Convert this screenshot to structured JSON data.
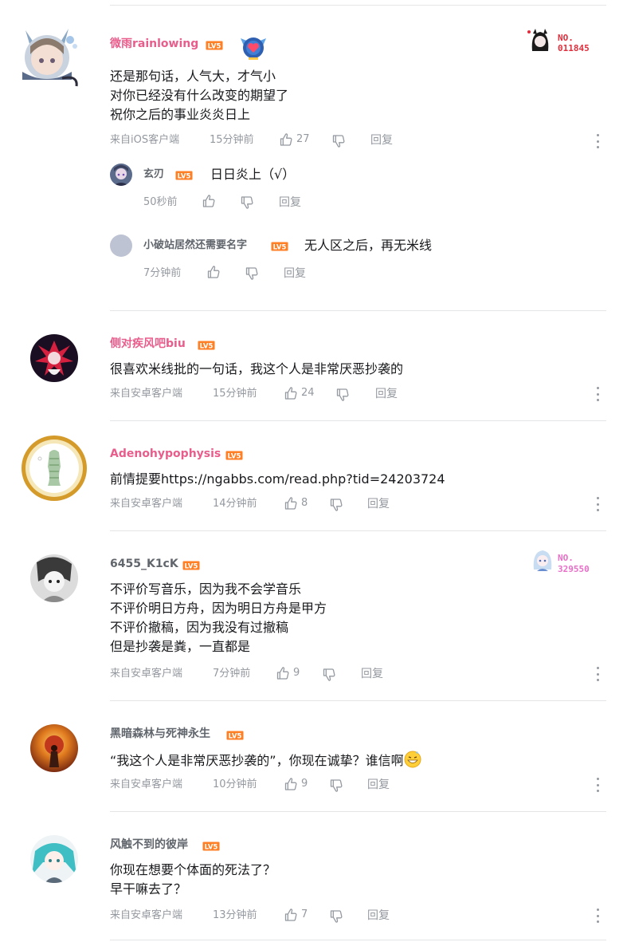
{
  "level_badge": "LV5",
  "colors": {
    "pink_name": "#e85d8c",
    "gray_name": "#61666d",
    "meta": "#9499a0",
    "badge_orange": "#ff7f24",
    "fan_red": "#e02e3c",
    "fan_pink": "#e86ec8"
  },
  "comments": [
    {
      "user": "微雨rainlowing",
      "lines": [
        "还是那句话，人气大，才气小",
        "对你已经没有什么改变的期望了",
        "祝你之后的事业炎炎日上"
      ],
      "source": "来自iOS客户端",
      "time": "15分钟前",
      "likes": "27",
      "reply": "回复",
      "fan_badge": {
        "label": "NO.",
        "number": "011845"
      },
      "replies": [
        {
          "user": "玄刃",
          "text": "日日炎上（√）",
          "time": "50秒前",
          "reply": "回复"
        },
        {
          "user": "小破站居然还需要名字",
          "text": "无人区之后，再无米线",
          "time": "7分钟前",
          "reply": "回复"
        }
      ]
    },
    {
      "user": "侧对疾风吧biu",
      "lines": [
        "很喜欢米线批的一句话，我这个人是非常厌恶抄袭的"
      ],
      "source": "来自安卓客户端",
      "time": "15分钟前",
      "likes": "24",
      "reply": "回复"
    },
    {
      "user": "Adenohypophysis",
      "lines": [
        "前情提要https://ngabbs.com/read.php?tid=24203724"
      ],
      "source": "来自安卓客户端",
      "time": "14分钟前",
      "likes": "8",
      "reply": "回复"
    },
    {
      "user": "6455_K1cK",
      "lines": [
        "不评价写音乐，因为我不会学音乐",
        "不评价明日方舟，因为明日方舟是甲方",
        "不评价撤稿，因为我没有过撤稿",
        "但是抄袭是粪，一直都是"
      ],
      "source": "来自安卓客户端",
      "time": "7分钟前",
      "likes": "9",
      "reply": "回复",
      "fan_badge": {
        "label": "NO.",
        "number": "329550"
      }
    },
    {
      "user": "黑暗森林与死神永生",
      "lines": [
        "“我这个人是非常厌恶抄袭的”，你现在诚挚？谁信啊"
      ],
      "source": "来自安卓客户端",
      "time": "10分钟前",
      "likes": "9",
      "reply": "回复"
    },
    {
      "user": "风触不到的彼岸",
      "lines": [
        "你现在想要个体面的死法了？",
        "早干嘛去了？"
      ],
      "source": "来自安卓客户端",
      "time": "13分钟前",
      "likes": "7",
      "reply": "回复"
    }
  ]
}
